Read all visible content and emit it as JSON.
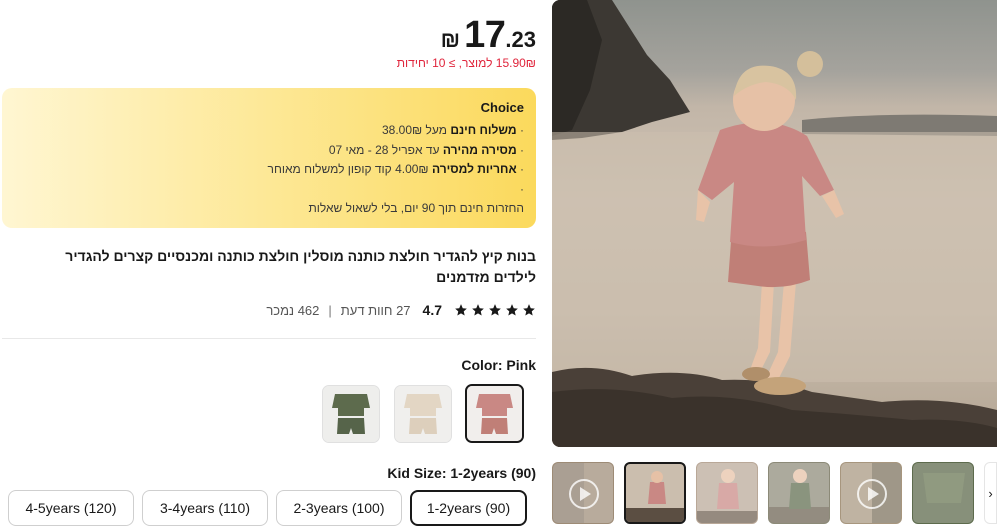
{
  "price": {
    "currency": "₪",
    "integer": "17",
    "decimal": ".23",
    "unit_price": "15.90₪ למוצר, ≥ 10 יחידות"
  },
  "choice": {
    "title": "Choice",
    "lines": [
      {
        "bullet": "·",
        "bold": "משלוח חינם",
        "text": " מעל 38.00₪"
      },
      {
        "bullet": "·",
        "bold": "מסירה מהירה",
        "text": " עד אפריל 28 - מאי 07"
      },
      {
        "bullet": "·",
        "bold": "אחריות למסירה",
        "text": " 4.00₪ קוד קופון למשלוח מאוחר"
      },
      {
        "bullet": "·",
        "bold": "",
        "text": ""
      },
      {
        "bullet": "",
        "bold": "",
        "text": "החזרות חינם תוך 90 יום, בלי לשאול שאלות"
      }
    ]
  },
  "product": {
    "title": "בנות קיץ להגדיר חולצת כותנה מוסלין חולצת כותנה ומכנסיים קצרים להגדיר לילדים מזדמנים"
  },
  "rating": {
    "score": "4.7",
    "reviews": "27 חוות דעת",
    "separator": "|",
    "sold": "462 נמכר",
    "stars": 5
  },
  "color": {
    "label": "Color: Pink",
    "options": [
      "Pink",
      "Beige",
      "Green"
    ],
    "selected": "Pink",
    "swatches": {
      "pink": "#c98884",
      "beige": "#e3d6c4",
      "green": "#5d6b4d"
    }
  },
  "size": {
    "label": "Kid Size: 1-2years (90)",
    "options": [
      "1-2years (90)",
      "2-3years (100)",
      "3-4years (110)",
      "4-5years (120)"
    ],
    "selected": "1-2years (90)"
  },
  "gallery": {
    "next_arrow": "›",
    "thumbnails": [
      "video-thumbnail",
      "girl-on-beach",
      "girl-standing",
      "boy-green-outfit",
      "video-thumbnail-2",
      "green-outfit-closeup"
    ]
  }
}
